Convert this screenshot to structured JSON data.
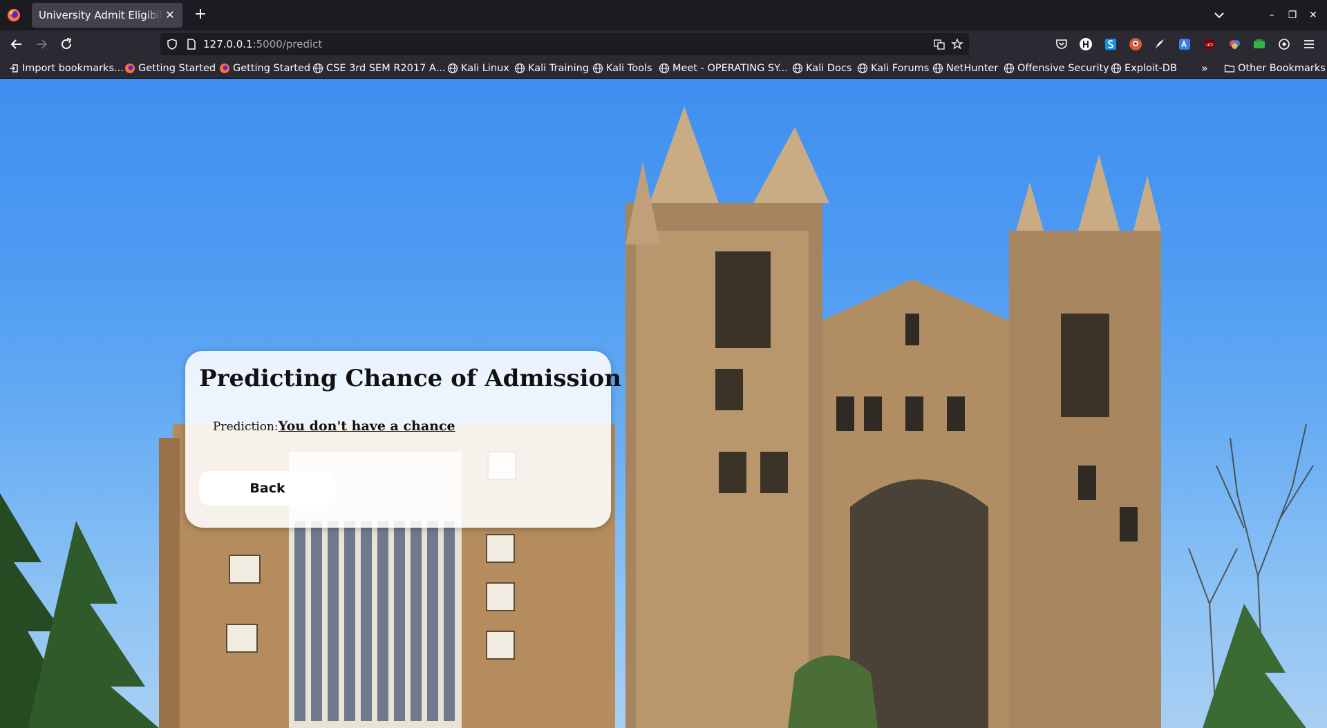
{
  "browser": {
    "tab": {
      "title": "University Admit Eligibility Predictor",
      "close_label": "✕"
    },
    "new_tab_label": "+",
    "url": {
      "host": "127.0.0.1",
      "path": ":5000/predict"
    },
    "window_controls": {
      "minimize": "–",
      "restore": "❐",
      "close": "✕"
    }
  },
  "bookmarks": {
    "items": [
      {
        "label": "Import bookmarks...",
        "icon": "import-icon"
      },
      {
        "label": "Getting Started",
        "icon": "firefox-icon"
      },
      {
        "label": "Getting Started",
        "icon": "firefox-icon"
      },
      {
        "label": "CSE 3rd SEM R2017 A...",
        "icon": "globe-icon"
      },
      {
        "label": "Kali Linux",
        "icon": "globe-icon"
      },
      {
        "label": "Kali Training",
        "icon": "globe-icon"
      },
      {
        "label": "Kali Tools",
        "icon": "globe-icon"
      },
      {
        "label": "Meet - OPERATING SY...",
        "icon": "globe-icon"
      },
      {
        "label": "Kali Docs",
        "icon": "globe-icon"
      },
      {
        "label": "Kali Forums",
        "icon": "globe-icon"
      },
      {
        "label": "NetHunter",
        "icon": "globe-icon"
      },
      {
        "label": "Offensive Security",
        "icon": "globe-icon"
      },
      {
        "label": "Exploit-DB",
        "icon": "globe-icon"
      }
    ],
    "overflow_label": "»",
    "other_label": "Other Bookmarks"
  },
  "page": {
    "title": "Predicting Chance of Admission",
    "prediction_label": "Prediction:",
    "prediction_value": "You don't have a chance",
    "back_label": "Back"
  },
  "colors": {
    "tabstrip": "#1c1b22",
    "toolbar": "#2b2a33",
    "sky": "#4f9cf2",
    "card": "#ffffff"
  }
}
